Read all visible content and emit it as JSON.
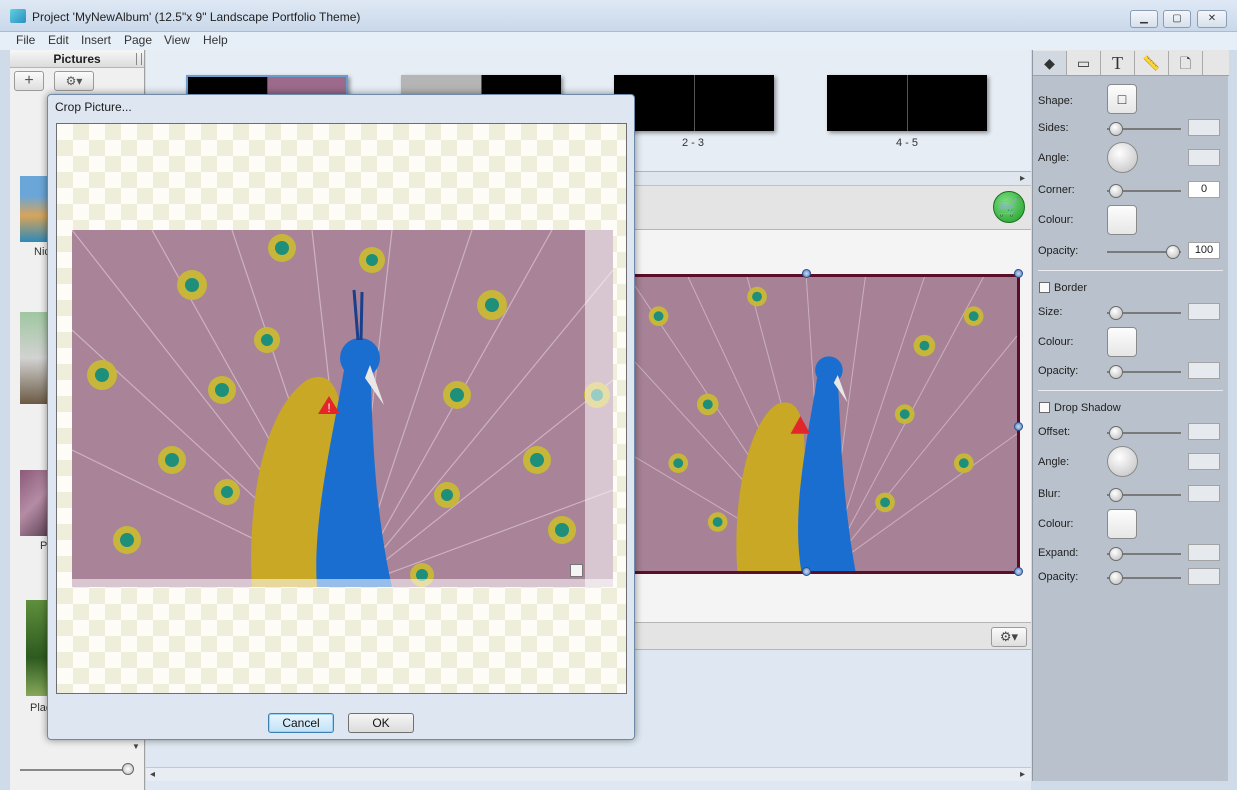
{
  "window": {
    "title": "Project 'MyNewAlbum' (12.5\"x 9\" Landscape Portfolio Theme)",
    "min": "▁",
    "max": "▢",
    "close": "✕"
  },
  "menu": [
    "File",
    "Edit",
    "Insert",
    "Page",
    "View",
    "Help"
  ],
  "pictures_panel": {
    "title": "Pictures",
    "add": "+",
    "gear": "⚙▾",
    "labels": [
      "Nic",
      "P",
      "Plac"
    ],
    "scroll_down": "▼"
  },
  "filmstrip": {
    "spreads": [
      {
        "label": ""
      },
      {
        "label": ""
      },
      {
        "label": "2 - 3"
      },
      {
        "label": "4 - 5"
      }
    ],
    "scroll_right": "▸"
  },
  "canvas": {
    "cart": "🛒",
    "gear": "⚙▾",
    "scroll_left": "◂",
    "scroll_right": "▸"
  },
  "properties": {
    "tabs": [
      "◆",
      "▭",
      "T",
      "📏",
      "🗋"
    ],
    "shape_label": "Shape:",
    "sides_label": "Sides:",
    "angle_label": "Angle:",
    "corner_label": "Corner:",
    "corner_value": "0",
    "colour_label": "Colour:",
    "opacity_label": "Opacity:",
    "opacity_value": "100",
    "border": {
      "title": "Border",
      "size_label": "Size:",
      "colour_label": "Colour:",
      "opacity_label": "Opacity:"
    },
    "drop_shadow": {
      "title": "Drop Shadow",
      "offset_label": "Offset:",
      "angle_label": "Angle:",
      "blur_label": "Blur:",
      "colour_label": "Colour:",
      "expand_label": "Expand:",
      "opacity_label": "Opacity:"
    }
  },
  "crop_dialog": {
    "title": "Crop Picture...",
    "cancel": "Cancel",
    "ok": "OK",
    "warning": "!"
  },
  "colors": {
    "accent": "#3c7fb1",
    "frame": "#5a0e28",
    "cart": "#1c9b2a"
  }
}
